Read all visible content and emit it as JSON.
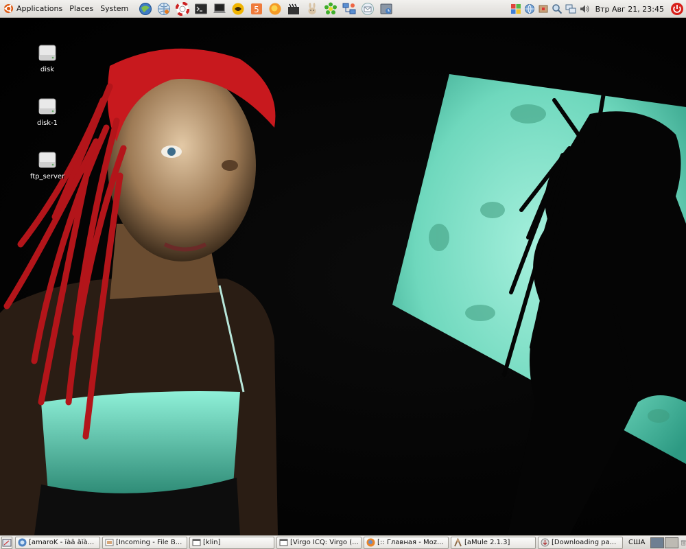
{
  "top_panel": {
    "menus": [
      {
        "label": "Applications"
      },
      {
        "label": "Places"
      },
      {
        "label": "System"
      }
    ],
    "launchers": [
      "web-browser-icon",
      "network-icon",
      "help-icon",
      "terminal-icon",
      "laptop-icon",
      "player-icon",
      "media-icon",
      "firefox-icon",
      "clapperboard-icon",
      "rabbit-icon",
      "icq-flower-icon",
      "network-manager-icon",
      "mail-icon",
      "archive-icon"
    ],
    "tray_icons": [
      "windows-flag-icon",
      "globe-icon",
      "package-icon",
      "search-icon",
      "network-status-icon",
      "volume-icon"
    ],
    "clock": "Втр Авг 21, 23:45"
  },
  "desktop": {
    "icons": [
      {
        "label": "disk"
      },
      {
        "label": "disk-1"
      },
      {
        "label": "ftp_server"
      }
    ]
  },
  "taskbar": {
    "tasks": [
      {
        "label": "[amaroK - ĭàä ăĭà..."
      },
      {
        "label": "[Incoming - File B..."
      },
      {
        "label": "[klin]"
      },
      {
        "label": "[Virgo ICQ: Virgo (..."
      },
      {
        "label": "[:: Главная - Moz..."
      },
      {
        "label": "[aMule 2.1.3]"
      },
      {
        "label": "[Downloading pa..."
      }
    ],
    "keyboard_layout": "США"
  },
  "colors": {
    "panel_bg": "#e6e4df",
    "wallpaper_screen": "#58c8b4",
    "hair": "#c8191e",
    "active_workspace": "#6e7f92"
  }
}
